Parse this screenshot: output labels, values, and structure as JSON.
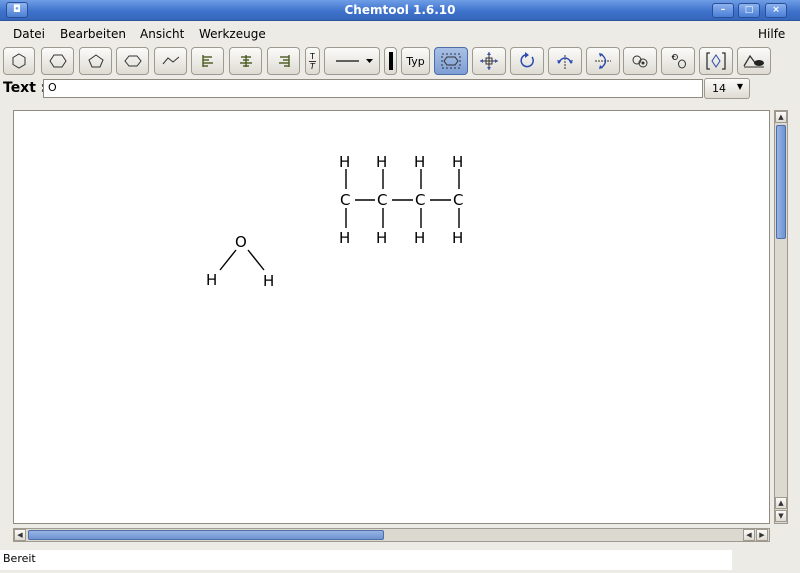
{
  "window": {
    "title": "Chemtool 1.6.10"
  },
  "menubar": {
    "items": [
      "Datei",
      "Bearbeiten",
      "Ansicht",
      "Werkzeuge"
    ],
    "help": "Hilfe"
  },
  "toolbar": {
    "buttons": [
      {
        "name": "hexagon-tool-icon"
      },
      {
        "name": "hexagon-rotated-tool-icon"
      },
      {
        "name": "pentagon-tool-icon"
      },
      {
        "name": "octagon-tool-icon"
      },
      {
        "name": "zigzag-chain-tool-icon"
      },
      {
        "name": "align-left-icon"
      },
      {
        "name": "align-center-icon"
      },
      {
        "name": "align-right-icon"
      },
      {
        "name": "text-sub-super-icon",
        "label": "T/T"
      },
      {
        "name": "bond-style-select"
      },
      {
        "name": "bond-width-icon"
      },
      {
        "name": "type-button",
        "label": "Typ"
      },
      {
        "name": "select-region-icon"
      },
      {
        "name": "move-icon"
      },
      {
        "name": "rotate-icon"
      },
      {
        "name": "flip-vertical-icon"
      },
      {
        "name": "flip-horizontal-icon"
      },
      {
        "name": "atom-link-icon"
      },
      {
        "name": "atom-link-alt-icon"
      },
      {
        "name": "bracket-icon"
      },
      {
        "name": "clear-icon"
      }
    ],
    "typ_label": "Typ",
    "text_sub_label": "T"
  },
  "textbar": {
    "label": "Text :",
    "value": "O",
    "size_value": "14"
  },
  "molecules": {
    "butane": {
      "top_h": [
        "H",
        "H",
        "H",
        "H"
      ],
      "carbons": [
        "C",
        "C",
        "C",
        "C"
      ],
      "bottom_h": [
        "H",
        "H",
        "H",
        "H"
      ]
    },
    "water": {
      "oxygen": "O",
      "h_left": "H",
      "h_right": "H"
    }
  },
  "statusbar": {
    "text": "Bereit"
  }
}
